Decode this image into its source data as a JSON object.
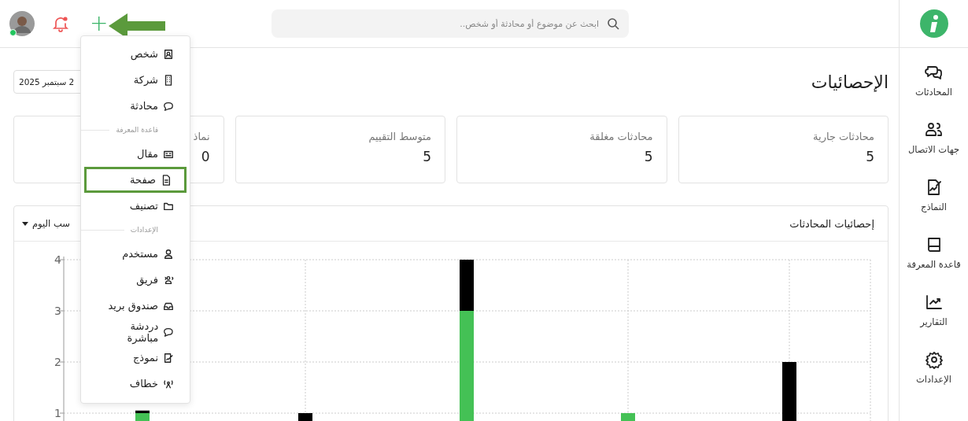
{
  "sidebar": {
    "items": [
      {
        "label": "المحادثات",
        "kind": "chats"
      },
      {
        "label": "جهات الاتصال",
        "kind": "contacts"
      },
      {
        "label": "النماذج",
        "kind": "forms"
      },
      {
        "label": "قاعدة المعرفة",
        "kind": "book"
      },
      {
        "label": "التقارير",
        "kind": "reports"
      },
      {
        "label": "الإعدادات",
        "kind": "settings"
      }
    ]
  },
  "top_bar": {
    "search": {
      "placeholder": "ابحث عن موضوع أو محادثة أو شخص.."
    },
    "notifications": {
      "unread": true
    },
    "avatar": {
      "online": true
    },
    "add_button": {
      "label": "+",
      "pointed_at": true
    }
  },
  "add_menu": [
    {
      "kind": "item",
      "label": "شخص",
      "highlighted": false
    },
    {
      "kind": "item",
      "label": "شركة",
      "highlighted": false
    },
    {
      "kind": "item",
      "label": "محادثة",
      "highlighted": false
    },
    {
      "kind": "section",
      "label": "قاعدة المعرفة"
    },
    {
      "kind": "item",
      "label": "مقال",
      "highlighted": false
    },
    {
      "kind": "item",
      "label": "صفحة",
      "highlighted": true
    },
    {
      "kind": "item",
      "label": "تصنيف",
      "highlighted": false
    },
    {
      "kind": "section",
      "label": "الإعدادات"
    },
    {
      "kind": "item",
      "label": "مستخدم",
      "highlighted": false
    },
    {
      "kind": "item",
      "label": "فريق",
      "highlighted": false
    },
    {
      "kind": "item",
      "label": "صندوق بريد",
      "highlighted": false
    },
    {
      "kind": "item",
      "label": "دردشة مباشرة",
      "highlighted": false
    },
    {
      "kind": "item",
      "label": "نموذج",
      "highlighted": false
    },
    {
      "kind": "item",
      "label": "خطاف",
      "highlighted": false
    }
  ],
  "page": {
    "title": "الإحصائيات",
    "date_range": "2 سبتمبر 2025"
  },
  "stat_cards": [
    {
      "label": "محادثات جارية",
      "value": "5"
    },
    {
      "label": "محادثات مغلقة",
      "value": "5"
    },
    {
      "label": "متوسط التقييم",
      "value": "5"
    },
    {
      "label": "نماذ",
      "value": "0"
    }
  ],
  "chart_panel": {
    "title": "إحصائيات المحادثات",
    "group_by": "سب اليوم",
    "chart_data": {
      "type": "bar",
      "stacked": true,
      "grid": true,
      "ylim": [
        0,
        4
      ],
      "yticks": [
        1,
        2,
        3,
        4
      ],
      "series": [
        {
          "color": "#44c155",
          "values": [
            1,
            null,
            3,
            1,
            null
          ]
        },
        {
          "color": "#000000",
          "values": [
            0.05,
            1,
            1,
            null,
            2
          ]
        }
      ]
    }
  }
}
